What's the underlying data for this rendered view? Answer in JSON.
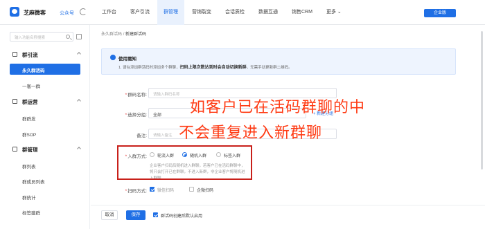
{
  "header": {
    "app_title": "芝麻微客",
    "account_link": "公众号",
    "nav": [
      {
        "label": "工作台"
      },
      {
        "label": "客户引流"
      },
      {
        "label": "群管理"
      },
      {
        "label": "营销裂变"
      },
      {
        "label": "会话质检"
      },
      {
        "label": "数据互通"
      },
      {
        "label": "销售CRM"
      },
      {
        "label": "更多 ⌄"
      }
    ],
    "active_nav": "群管理",
    "enterprise_button": "企业版"
  },
  "sidebar": {
    "search_placeholder": "输入功能名称搜索",
    "groups": [
      {
        "label": "群引流",
        "items": [
          {
            "label": "永久群活码"
          },
          {
            "label": "一客一群"
          }
        ]
      },
      {
        "label": "群运营",
        "items": [
          {
            "label": "群群发"
          },
          {
            "label": "群SOP"
          }
        ]
      },
      {
        "label": "群管理",
        "items": [
          {
            "label": "群列表"
          },
          {
            "label": "群成员列表"
          },
          {
            "label": "群统计"
          },
          {
            "label": "标签建群"
          }
        ]
      }
    ],
    "active_item": "永久群活码"
  },
  "main": {
    "breadcrumb": {
      "parent": "永久群活码",
      "separator": "/",
      "current": "新建群活码"
    },
    "notice": {
      "title": "使用需知",
      "text_prefix": "1. 请在添加群活码时添加多个群聊，",
      "text_bold": "扫码上限次数达到时会自动切换新群",
      "text_suffix": "，无需手动更新群二维码。"
    },
    "form": {
      "name_label": "群码名称:",
      "name_placeholder": "请输入群码名称",
      "group_label": "选择分组:",
      "group_value": "全部",
      "add_group_link": "+ 新建分组",
      "note_label": "备注:",
      "note_placeholder": "请输入备注",
      "join_label": "入群方式:",
      "join_options": [
        {
          "label": "轮流入群",
          "selected": false
        },
        {
          "label": "随机入群",
          "selected": true
        },
        {
          "label": "标签入群",
          "selected": false
        }
      ],
      "join_help": "企业客户扫码后随机进入群聊，若客户已在活码群聊中，将只会打开已在群聊，不进入新群，非企业客户将随机进入群聊",
      "scan_label": "扫码方式:",
      "scan_options": [
        {
          "label": "微信扫码",
          "checked": true
        },
        {
          "label": "企微扫码",
          "checked": false
        }
      ]
    },
    "overlay": {
      "line1": "如客户已在活码群聊的中",
      "line2": "不会重复进入新群聊"
    },
    "footer": {
      "cancel": "取消",
      "save": "保存",
      "default_checkbox_label": "群活码创建后默认启用",
      "default_checked": true
    }
  },
  "colors": {
    "accent": "#1f6fe5",
    "overlay_text": "#ff3b14",
    "highlight_border": "#c8201a"
  }
}
